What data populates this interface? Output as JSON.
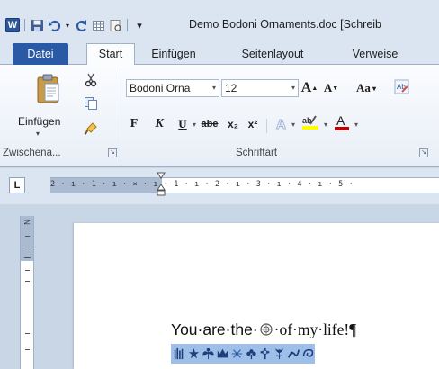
{
  "titlebar": {
    "title": "Demo Bodoni Ornaments.doc [Schreib",
    "app_logo": "W"
  },
  "tabs": [
    {
      "label": "Datei",
      "type": "file"
    },
    {
      "label": "Start",
      "active": true
    },
    {
      "label": "Einfügen"
    },
    {
      "label": "Seitenlayout"
    },
    {
      "label": "Verweise"
    }
  ],
  "clipboard": {
    "paste_label": "Einfügen",
    "group_label": "Zwischena..."
  },
  "font": {
    "family": "Bodoni Orna",
    "size": "12",
    "bold_label": "F",
    "italic_label": "K",
    "underline_label": "U",
    "strike_label": "abe",
    "subscript_label": "x₂",
    "superscript_label": "x²",
    "grow_label": "A",
    "shrink_label": "A",
    "case_label": "Aa",
    "group_label": "Schriftart"
  },
  "ruler": {
    "tab_selector": "L",
    "marks": "2 · ı · 1 · ı · ⨯ · ı · 1 · ı · 2 · ı · 3 · ı · 4 · ı · 5 ·"
  },
  "document": {
    "line1_before": "You·are·the·",
    "line1_after": "·of·my·life!¶"
  },
  "colors": {
    "file_tab": "#2a5aa6",
    "highlight": "#9ec0e8",
    "font_color": "#c00000",
    "highlighter": "#ffff00"
  }
}
